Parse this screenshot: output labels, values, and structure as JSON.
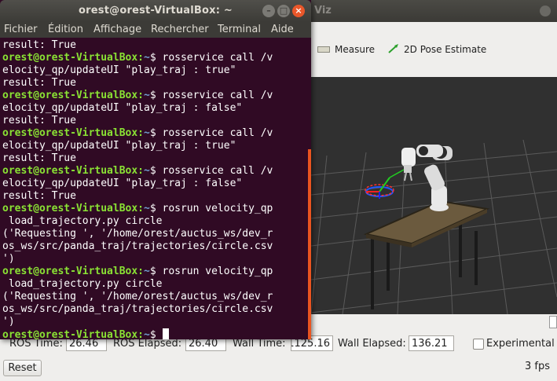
{
  "rviz": {
    "title": "Viz",
    "tools": {
      "measure_label": "Measure",
      "pose_label": "2D Pose Estimate"
    },
    "time": {
      "ros_time_label": "ROS Time:",
      "ros_time_value": "26.46",
      "ros_elapsed_label": "ROS Elapsed:",
      "ros_elapsed_value": "26.40",
      "wall_time_label": "Wall Time:",
      "wall_time_value": "1125.16",
      "wall_elapsed_label": "Wall Elapsed:",
      "wall_elapsed_value": "136.21",
      "experimental_label": "Experimental",
      "reset_label": "Reset",
      "fps": "3 fps"
    }
  },
  "terminal": {
    "title": "orest@orest-VirtualBox: ~",
    "menu": [
      "Fichier",
      "Édition",
      "Affichage",
      "Rechercher",
      "Terminal",
      "Aide"
    ],
    "lines": [
      {
        "text": "result: True"
      },
      {
        "prompt": "orest@orest-VirtualBox:",
        "path": "~",
        "text": "$ rosservice call /v"
      },
      {
        "text": "elocity_qp/updateUI \"play_traj : true\""
      },
      {
        "text": "result: True"
      },
      {
        "prompt": "orest@orest-VirtualBox:",
        "path": "~",
        "text": "$ rosservice call /v"
      },
      {
        "text": "elocity_qp/updateUI \"play_traj : false\""
      },
      {
        "text": "result: True"
      },
      {
        "prompt": "orest@orest-VirtualBox:",
        "path": "~",
        "text": "$ rosservice call /v"
      },
      {
        "text": "elocity_qp/updateUI \"play_traj : true\""
      },
      {
        "text": "result: True"
      },
      {
        "prompt": "orest@orest-VirtualBox:",
        "path": "~",
        "text": "$ rosservice call /v"
      },
      {
        "text": "elocity_qp/updateUI \"play_traj : false\""
      },
      {
        "text": "result: True"
      },
      {
        "prompt": "orest@orest-VirtualBox:",
        "path": "~",
        "text": "$ rosrun velocity_qp"
      },
      {
        "text": " load_trajectory.py circle"
      },
      {
        "text": "('Requesting ', '/home/orest/auctus_ws/dev_r"
      },
      {
        "text": "os_ws/src/panda_traj/trajectories/circle.csv"
      },
      {
        "text": "')"
      },
      {
        "prompt": "orest@orest-VirtualBox:",
        "path": "~",
        "text": "$ rosrun velocity_qp"
      },
      {
        "text": " load_trajectory.py circle"
      },
      {
        "text": "('Requesting ', '/home/orest/auctus_ws/dev_r"
      },
      {
        "text": "os_ws/src/panda_traj/trajectories/circle.csv"
      },
      {
        "text": "')"
      },
      {
        "prompt": "orest@orest-VirtualBox:",
        "path": "~",
        "text": "$ ",
        "cursor": true
      }
    ]
  },
  "colors": {
    "terminal_bg": "#300a24",
    "prompt_green": "#8ae234",
    "path_blue": "#729fcf",
    "ubuntu_orange": "#e95420"
  }
}
